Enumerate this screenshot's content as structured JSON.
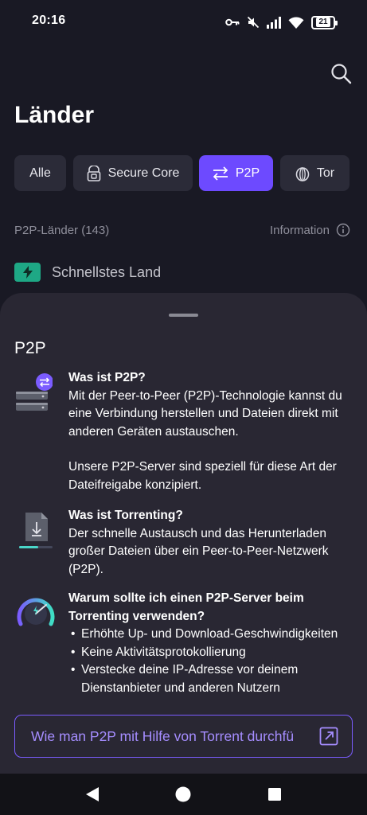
{
  "status_bar": {
    "time": "20:16",
    "battery": "21"
  },
  "header": {
    "title": "Länder"
  },
  "filters": [
    {
      "label": "Alle",
      "icon": ""
    },
    {
      "label": "Secure Core",
      "icon": "secure-core-icon"
    },
    {
      "label": "P2P",
      "icon": "p2p-arrows-icon"
    },
    {
      "label": "Tor",
      "icon": "tor-onion-icon"
    }
  ],
  "active_filter": "P2P",
  "list_header": {
    "count_label": "P2P-Länder (143)",
    "info_label": "Information"
  },
  "fastest": {
    "label": "Schnellstes Land"
  },
  "sheet": {
    "title": "P2P",
    "sections": [
      {
        "heading": "Was ist P2P?",
        "paragraphs": [
          "Mit der Peer-to-Peer (P2P)-Technologie kannst du eine Verbindung herstellen und Dateien direkt mit anderen Geräten austauschen.",
          "Unsere P2P-Server sind speziell für diese Art der Dateifreigabe konzipiert."
        ]
      },
      {
        "heading": "Was ist Torrenting?",
        "paragraphs": [
          "Der schnelle Austausch und das Herunterladen großer Dateien über ein Peer-to-Peer-Netzwerk (P2P)."
        ]
      },
      {
        "heading": "Warum sollte ich einen P2P-Server beim Torrenting verwenden?",
        "bullets": [
          "Erhöhte Up- und Download-Geschwindigkeiten",
          "Keine Aktivitätsprotokollierung",
          "Verstecke deine IP-Adresse vor deinem Dienstanbieter und anderen Nutzern"
        ]
      }
    ],
    "cta_label": "Wie man P2P mit Hilfe von Torrent durchfü"
  },
  "colors": {
    "accent": "#6d4aff",
    "background": "#191924",
    "sheet": "#292733",
    "fastest_badge": "#1ea885"
  }
}
